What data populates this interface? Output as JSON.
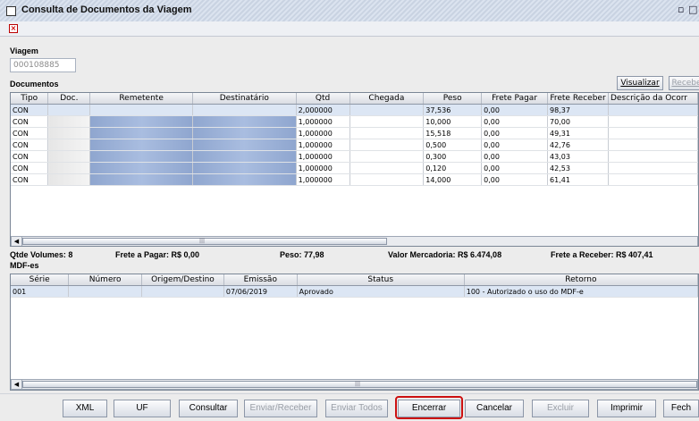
{
  "window": {
    "title": "Consulta de Documentos da Viagem",
    "controls": "▫°"
  },
  "viagem": {
    "label": "Viagem",
    "value": "000108885"
  },
  "documentos": {
    "label": "Documentos",
    "visualizar": "Visualizar",
    "receber": "Recebe",
    "columns": [
      "Tipo",
      "Doc.",
      "Remetente",
      "Destinatário",
      "Qtd",
      "Chegada",
      "Peso",
      "Frete Pagar",
      "Frete Receber",
      "Descrição da Ocorr"
    ],
    "rows": [
      {
        "tipo": "CON",
        "qtd": "2,000000",
        "peso": "37,536",
        "frete_pagar": "0,00",
        "frete_receber": "98,37"
      },
      {
        "tipo": "CON",
        "qtd": "1,000000",
        "peso": "10,000",
        "frete_pagar": "0,00",
        "frete_receber": "70,00"
      },
      {
        "tipo": "CON",
        "qtd": "1,000000",
        "peso": "15,518",
        "frete_pagar": "0,00",
        "frete_receber": "49,31"
      },
      {
        "tipo": "CON",
        "qtd": "1,000000",
        "peso": "0,500",
        "frete_pagar": "0,00",
        "frete_receber": "42,76"
      },
      {
        "tipo": "CON",
        "qtd": "1,000000",
        "peso": "0,300",
        "frete_pagar": "0,00",
        "frete_receber": "43,03"
      },
      {
        "tipo": "CON",
        "qtd": "1,000000",
        "peso": "0,120",
        "frete_pagar": "0,00",
        "frete_receber": "42,53"
      },
      {
        "tipo": "CON",
        "qtd": "1,000000",
        "peso": "14,000",
        "frete_pagar": "0,00",
        "frete_receber": "61,41"
      }
    ]
  },
  "summary": {
    "volumes": "Qtde Volumes: 8",
    "frete_pagar": "Frete a Pagar: R$ 0,00",
    "peso": "Peso: 77,98",
    "valor_mercadoria": "Valor Mercadoria: R$ 6.474,08",
    "frete_receber": "Frete a Receber: R$ 407,41"
  },
  "mdfe": {
    "label": "MDF-es",
    "columns": [
      "Série",
      "Número",
      "Origem/Destino",
      "Emissão",
      "Status",
      "Retorno"
    ],
    "rows": [
      {
        "serie": "001",
        "emissao": "07/06/2019",
        "status": "Aprovado",
        "retorno": "100 - Autorizado o uso do MDF-e"
      }
    ]
  },
  "buttons": {
    "xml": "XML",
    "uf": "UF",
    "consultar": "Consultar",
    "enviar_receber": "Enviar/Receber",
    "enviar_todos": "Enviar Todos",
    "encerrar": "Encerrar",
    "cancelar": "Cancelar",
    "excluir": "Excluir",
    "imprimir": "Imprimir",
    "fechar": "Fech"
  }
}
